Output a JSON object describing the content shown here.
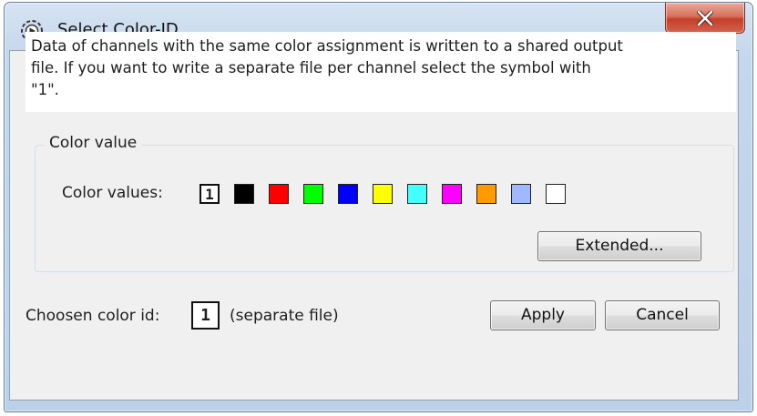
{
  "window": {
    "title": "Select Color-ID",
    "close_icon": "close-icon"
  },
  "info": {
    "lines": [
      "Data of channels with the same color assignment is written to a shared output",
      "file. If you want to write a separate file per channel select the symbol with",
      "\"1\"."
    ]
  },
  "color_group": {
    "title": "Color value",
    "label": "Color values:",
    "separate_symbol": "1",
    "colors": [
      "#000000",
      "#ff0000",
      "#00ff00",
      "#0000ff",
      "#ffff00",
      "#44ffff",
      "#ff00ff",
      "#ff9a00",
      "#a0b8ff",
      "#ffffff"
    ],
    "extended_label": "Extended..."
  },
  "chosen": {
    "label": "Choosen color id:",
    "value": "1",
    "description": "(separate file)"
  },
  "buttons": {
    "apply": "Apply",
    "cancel": "Cancel"
  }
}
